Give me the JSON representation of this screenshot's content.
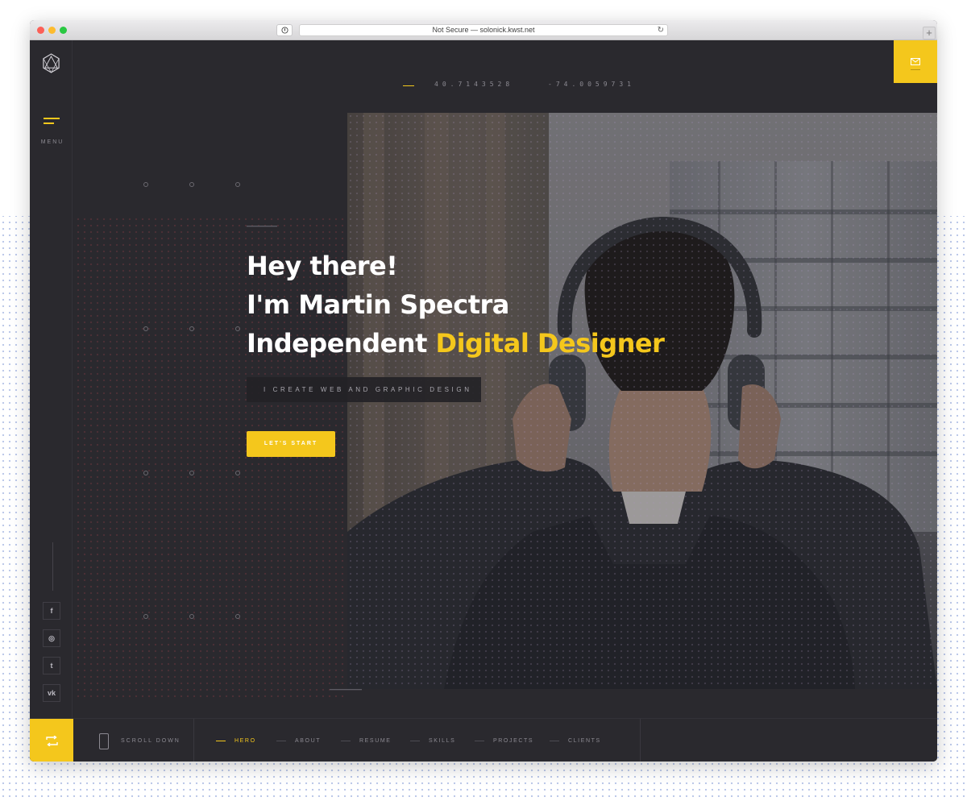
{
  "browser": {
    "url_text": "Not Secure — solonick.kwst.net",
    "reload_icon": "reload-icon",
    "newtab_label": "+"
  },
  "sidebar": {
    "menu_label": "MENU",
    "social": [
      {
        "name": "facebook-icon",
        "glyph": "f"
      },
      {
        "name": "instagram-icon",
        "glyph": "◎"
      },
      {
        "name": "twitter-icon",
        "glyph": "t"
      },
      {
        "name": "vk-icon",
        "glyph": "vk"
      }
    ]
  },
  "topbar": {
    "latitude": "40.7143528",
    "longitude": "-74.0059731"
  },
  "hero": {
    "line1": "Hey there!",
    "line2": "I'm Martin Spectra",
    "line3_prefix": "Independent ",
    "line3_accent": "Digital Designer",
    "tagline": "I CREATE WEB AND GRAPHIC DESIGN",
    "cta_label": "LET'S START"
  },
  "footer": {
    "scroll_label": "SCROLL DOWN",
    "nav": [
      "HERO",
      "ABOUT",
      "RESUME",
      "SKILLS",
      "PROJECTS",
      "CLIENTS"
    ]
  },
  "colors": {
    "accent": "#f4c71c",
    "background": "#2a292e"
  }
}
